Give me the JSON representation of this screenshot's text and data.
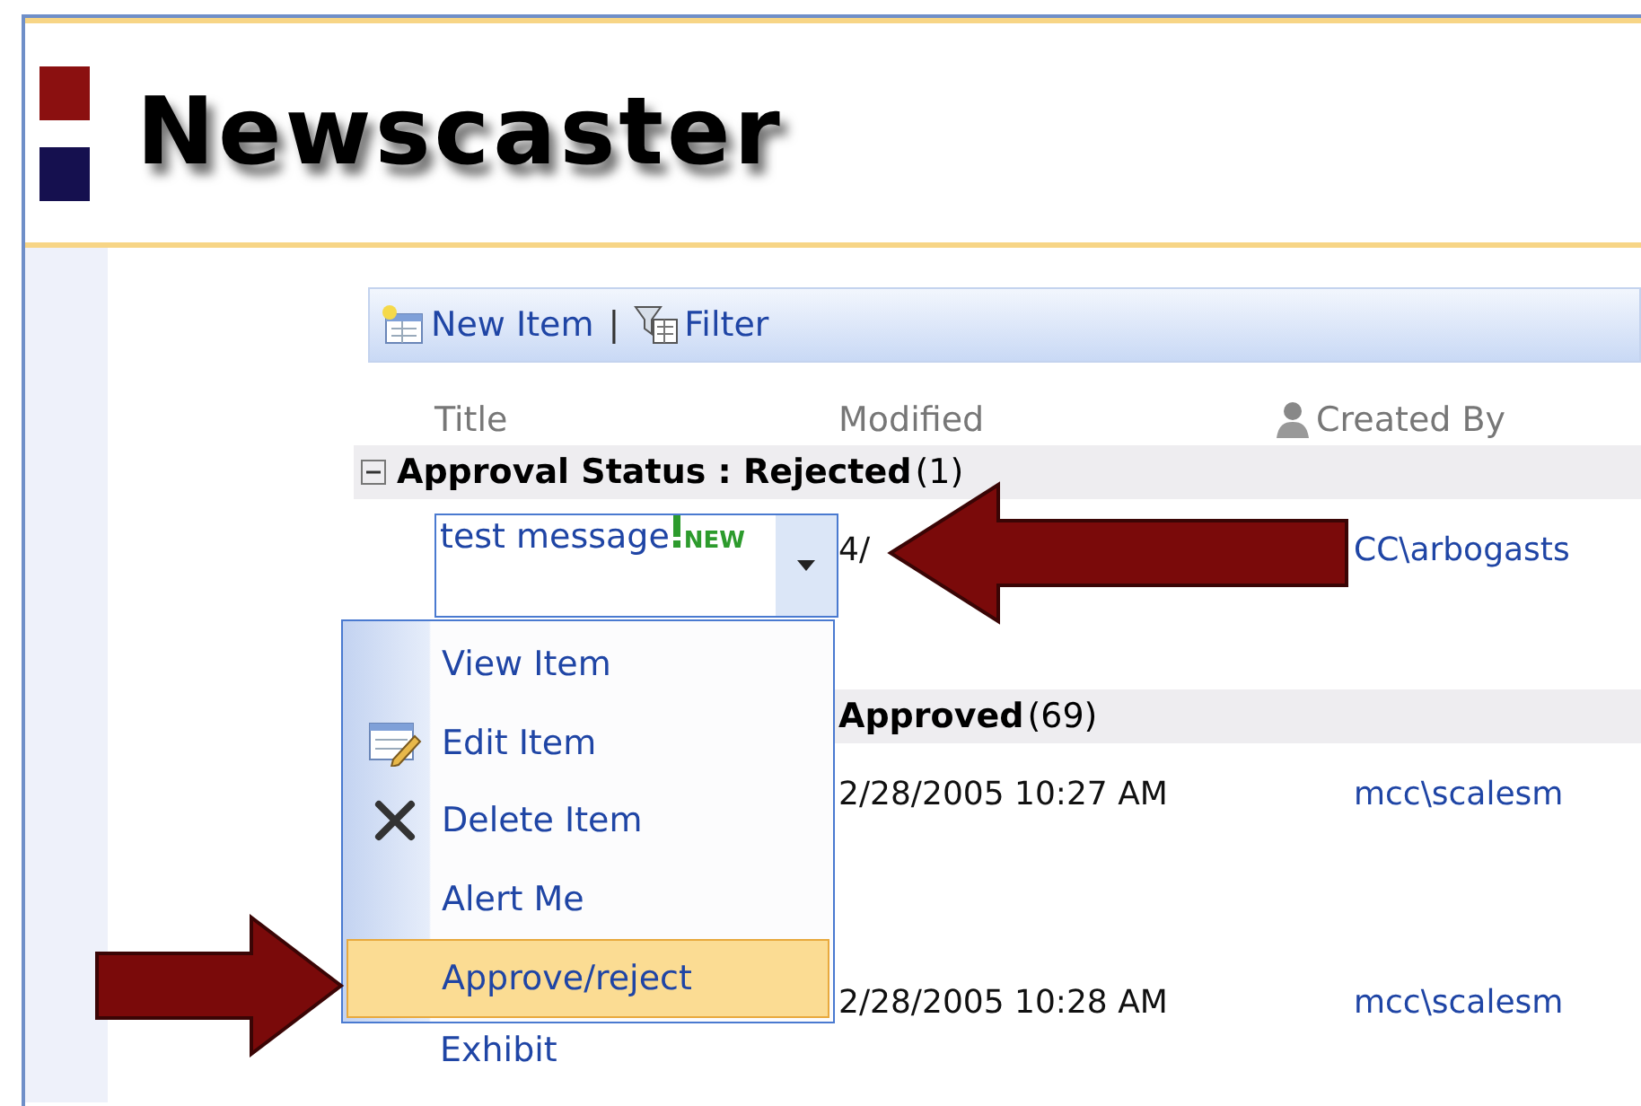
{
  "header": {
    "title": "Newscaster"
  },
  "toolbar": {
    "items": [
      {
        "label": "New Item",
        "kind": "new"
      },
      {
        "label": "Filter",
        "kind": "filter"
      }
    ],
    "separator": "|"
  },
  "columns": [
    {
      "label": "Title",
      "kind": "plain"
    },
    {
      "label": "Modified",
      "kind": "plain"
    },
    {
      "label": "Created By",
      "kind": "person"
    }
  ],
  "groups": [
    {
      "label": "Approval Status : Rejected",
      "count": "(1)",
      "expanded": true,
      "rows": [
        {
          "title": "test message",
          "badge": "NEW",
          "modified": "4/",
          "created_by": "CC\\arbogasts",
          "selected": true
        }
      ]
    },
    {
      "label": "Approved",
      "count": "(69)",
      "rows": [
        {
          "modified": "2/28/2005 10:27 AM",
          "created_by": "mcc\\scalesm"
        },
        {
          "title": "Exhibit",
          "modified": "2/28/2005 10:28 AM",
          "created_by": "mcc\\scalesm"
        }
      ]
    }
  ],
  "menu": {
    "items": [
      {
        "label": "View Item",
        "kind": "plain",
        "selected": false
      },
      {
        "label": "Edit Item",
        "kind": "edit",
        "selected": false
      },
      {
        "label": "Delete Item",
        "kind": "delete",
        "selected": false
      },
      {
        "label": "Alert Me",
        "kind": "plain",
        "selected": false
      },
      {
        "label": "Approve/reject",
        "kind": "plain",
        "selected": true
      }
    ]
  },
  "annotations": [
    {
      "kind": "arrow_left"
    },
    {
      "kind": "arrow_right"
    }
  ]
}
